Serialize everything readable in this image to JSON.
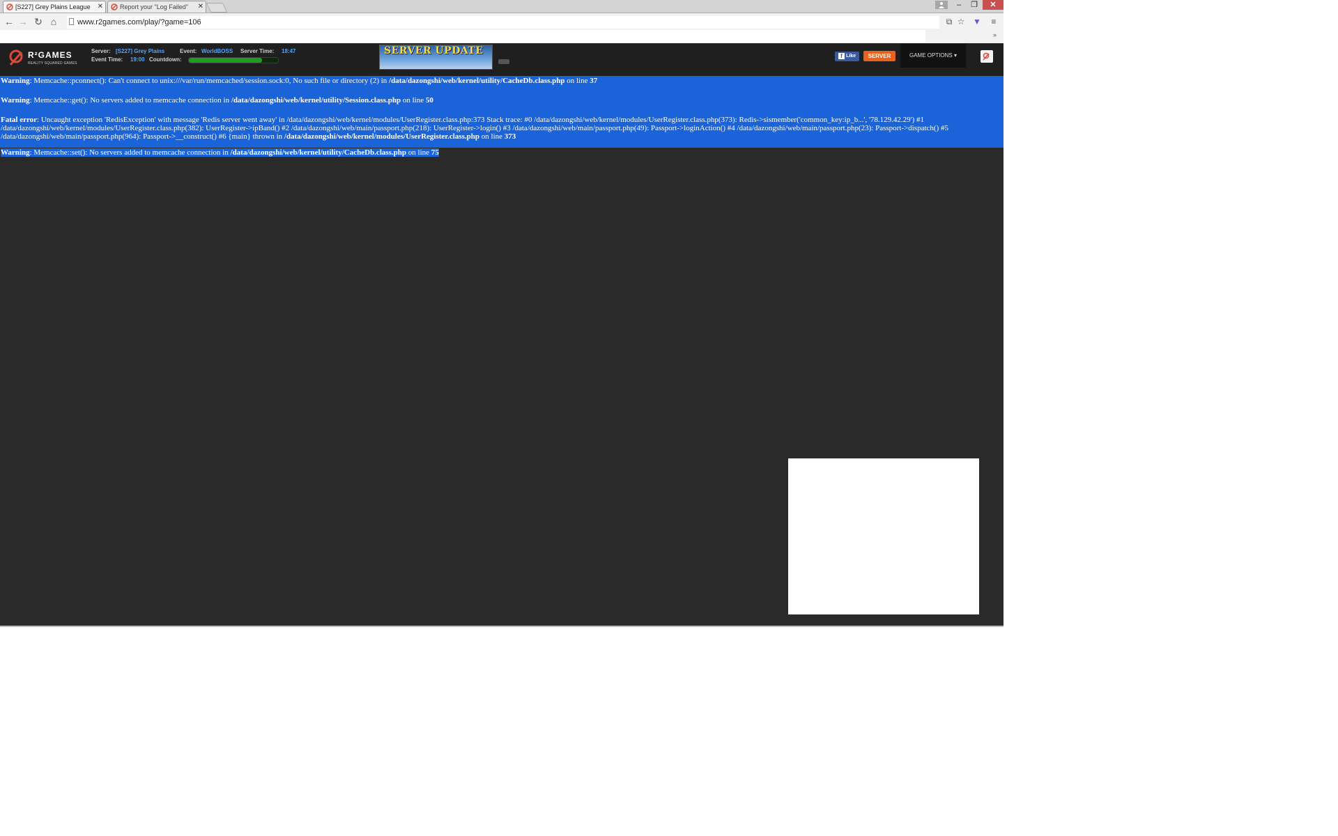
{
  "browser": {
    "tabs": [
      {
        "title": "[S227] Grey Plains League"
      },
      {
        "title": "Report your \"Log Failed\""
      }
    ],
    "url": "www.r2games.com/play/?game=106",
    "window_controls": {
      "minimize": "–",
      "maximize": "❐",
      "close": "✕"
    }
  },
  "header": {
    "logo_text": "R²GAMES",
    "logo_tagline": "REALITY SQUARED GAMES",
    "server_label": "Server:",
    "server_value": "[S227] Grey Plains",
    "event_label": "Event:",
    "event_value": "WorldBOSS",
    "server_time_label": "Server Time:",
    "server_time_value": "18:47",
    "event_time_label": "Event Time:",
    "event_time_value": "19:00",
    "countdown_label": "Countdown:",
    "countdown_progress": 0.82,
    "banner_text": "SERVER UPDATE",
    "like_label": "Like",
    "server_button": "SERVER",
    "game_options": "GAME OPTIONS ▾"
  },
  "errors": {
    "e1": {
      "lead": "Warning",
      "msg": ": Memcache::pconnect(): Can't connect to unix:///var/run/memcached/session.sock:0, No such file or directory (2) in ",
      "file": "/data/dazongshi/web/kernel/utility/CacheDb.class.php",
      "on": " on line ",
      "line": "37"
    },
    "e2": {
      "lead": "Warning",
      "msg": ": Memcache::get(): No servers added to memcache connection in ",
      "file": "/data/dazongshi/web/kernel/utility/Session.class.php",
      "on": " on line ",
      "line": "50"
    },
    "e3": {
      "lead": "Fatal error",
      "msg": ": Uncaught exception 'RedisException' with message 'Redis server went away' in /data/dazongshi/web/kernel/modules/UserRegister.class.php:373 Stack trace: #0 /data/dazongshi/web/kernel/modules/UserRegister.class.php(373): Redis->sismember('common_key:ip_b...', '78.129.42.29') #1 /data/dazongshi/web/kernel/modules/UserRegister.class.php(382): UserRegister->ipBand() #2 /data/dazongshi/web/main/passport.php(218): UserRegister->login() #3 /data/dazongshi/web/main/passport.php(49): Passport->loginAction() #4 /data/dazongshi/web/main/passport.php(23): Passport->dispatch() #5 /data/dazongshi/web/main/passport.php(964): Passport->__construct() #6 {main} thrown in ",
      "file": "/data/dazongshi/web/kernel/modules/UserRegister.class.php",
      "on": " on line ",
      "line": "373"
    },
    "e4": {
      "lead": "Warning",
      "msg": ": Memcache::set(): No servers added to memcache connection in ",
      "file": "/data/dazongshi/web/kernel/utility/CacheDb.class.php",
      "on": " on line ",
      "line": "75"
    }
  },
  "colors": {
    "selection": "#1a63d9",
    "page_bg": "#2a2a2a",
    "accent_orange": "#e8611f",
    "link_blue": "#4ea6ff"
  }
}
